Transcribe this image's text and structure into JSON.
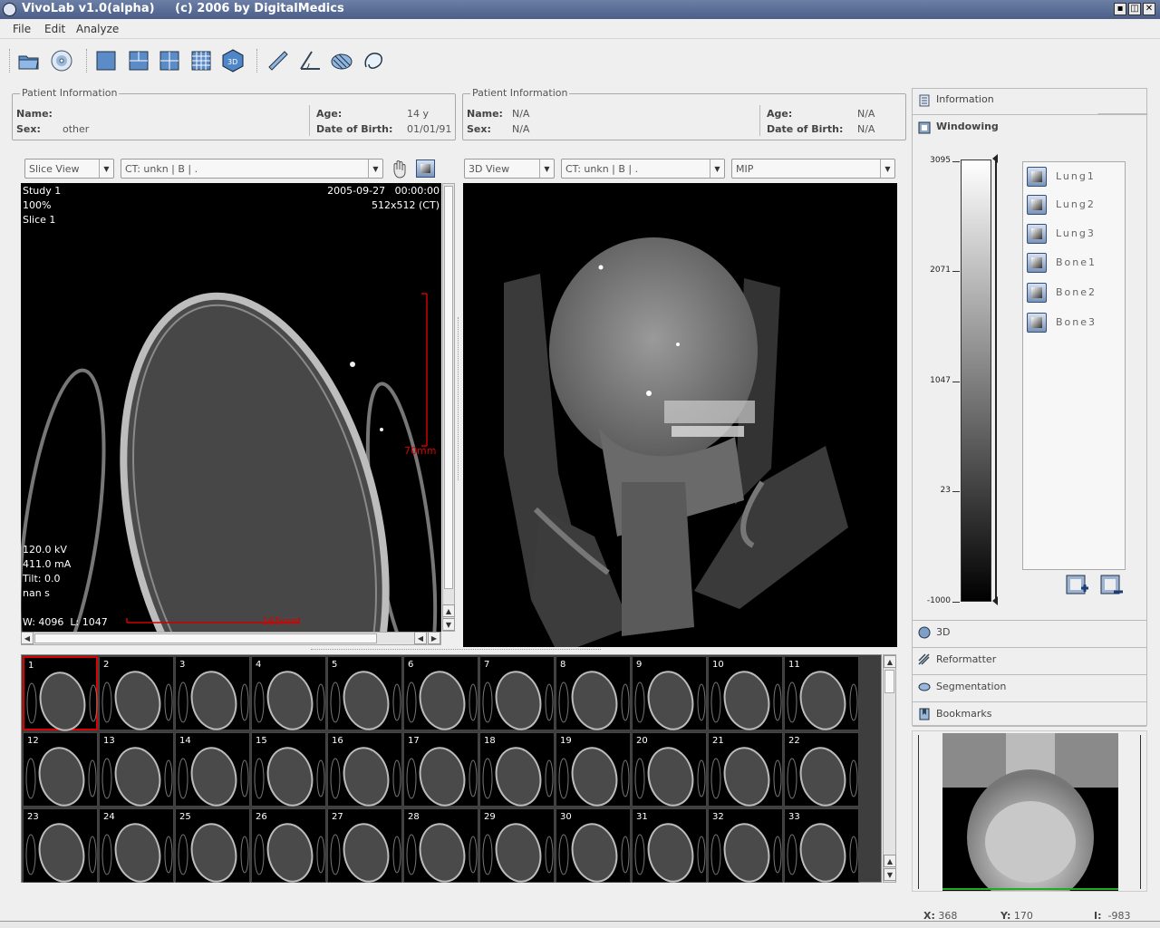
{
  "window": {
    "title": "VivoLab v1.0(alpha)     (c) 2006 by DigitalMedics"
  },
  "menu": [
    "File",
    "Edit",
    "Analyze"
  ],
  "toolbar": [
    "open-folder-icon",
    "cd-icon",
    "single-view-icon",
    "split-view-icon",
    "quad-view-icon",
    "grid-view-icon",
    "3d-cube-icon",
    "ruler-icon",
    "angle-icon",
    "volume-icon",
    "lasso-icon"
  ],
  "patient_left": {
    "title": "Patient Information",
    "name_label": "Name:",
    "name_value": "",
    "sex_label": "Sex:",
    "sex_value": "other",
    "age_label": "Age:",
    "age_value": "14 y",
    "dob_label": "Date of Birth:",
    "dob_value": "01/01/91"
  },
  "patient_right": {
    "title": "Patient Information",
    "name_label": "Name:",
    "name_value": "N/A",
    "sex_label": "Sex:",
    "sex_value": "N/A",
    "age_label": "Age:",
    "age_value": "N/A",
    "dob_label": "Date of Birth:",
    "dob_value": "N/A"
  },
  "slice_view": {
    "view_select": "Slice View",
    "series_select": "CT: unkn | B | .",
    "study": "Study 1",
    "zoom": "100%",
    "slice": "Slice 1",
    "date": "2005-09-27",
    "time": "00:00:00",
    "dims": "512x512 (CT)",
    "kv": "120.0 kV",
    "ma": "411.0 mA",
    "tilt": "Tilt: 0.0",
    "time_s": "nan s",
    "wl": "W: 4096  L: 1047",
    "scale_v": "70mm",
    "scale_h": "165mm"
  },
  "view3d": {
    "view_select": "3D View",
    "series_select": "CT: unkn | B | .",
    "mode_select": "MIP"
  },
  "thumbnails": {
    "rows": [
      [
        "1",
        "2",
        "3",
        "4",
        "5",
        "6",
        "7",
        "8",
        "9",
        "10",
        "11"
      ],
      [
        "12",
        "13",
        "14",
        "15",
        "16",
        "17",
        "18",
        "19",
        "20",
        "21",
        "22"
      ],
      [
        "23",
        "24",
        "25",
        "26",
        "27",
        "28",
        "29",
        "30",
        "31",
        "32",
        "33"
      ]
    ],
    "selected": "1"
  },
  "right_panel": {
    "information": "Information",
    "windowing": "Windowing",
    "ticks": [
      "3095",
      "2071",
      "1047",
      "23",
      "-1000"
    ],
    "presets": [
      "Lung1",
      "Lung2",
      "Lung3",
      "Bone1",
      "Bone2",
      "Bone3"
    ],
    "sections": [
      "3D",
      "Reformatter",
      "Segmentation",
      "Bookmarks"
    ]
  },
  "status": {
    "x_label": "X:",
    "x": "368",
    "y_label": "Y:",
    "y": "170",
    "i_label": "I:",
    "i": "-983"
  }
}
